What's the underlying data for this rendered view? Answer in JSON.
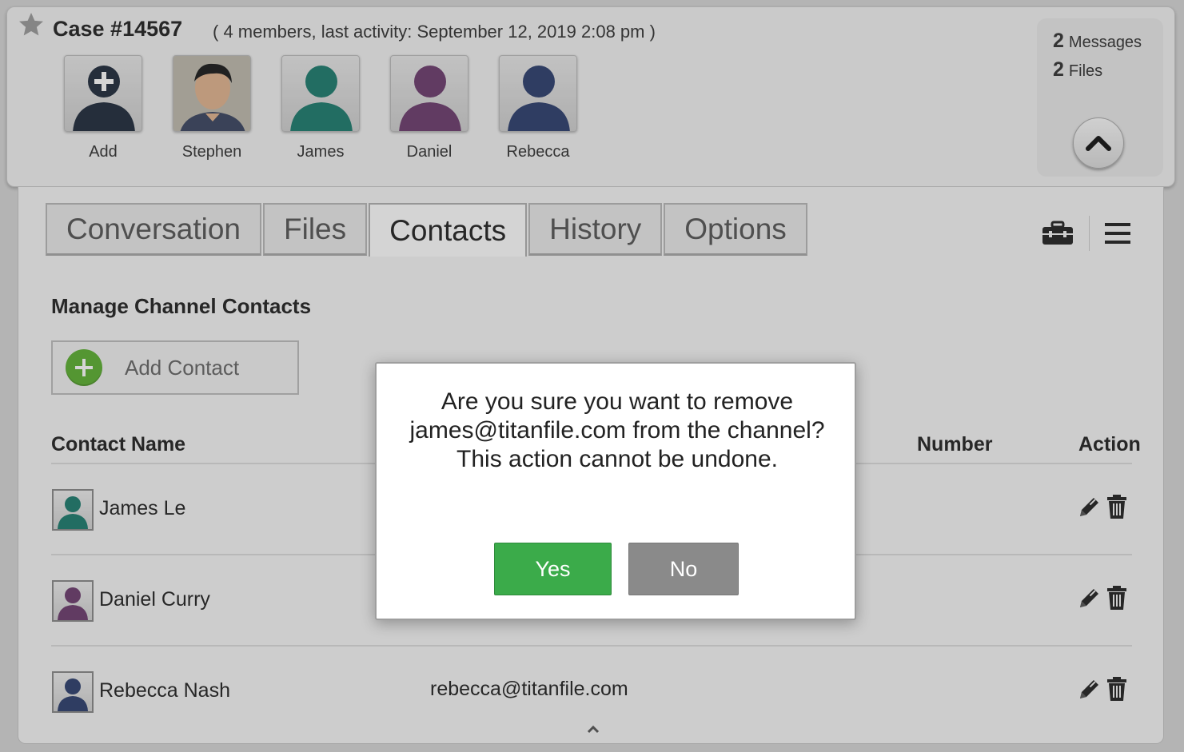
{
  "header": {
    "case_title": "Case #14567",
    "case_meta": "( 4 members, last activity: September 12, 2019 2:08 pm )",
    "members": [
      {
        "label": "Add",
        "color": "#1f2b3c"
      },
      {
        "label": "Stephen",
        "color": "photo"
      },
      {
        "label": "James",
        "color": "#1c7c6e"
      },
      {
        "label": "Daniel",
        "color": "#6c3b6e"
      },
      {
        "label": "Rebecca",
        "color": "#2c3e6e"
      }
    ],
    "stats": {
      "messages_count": "2",
      "messages_label": "Messages",
      "files_count": "2",
      "files_label": "Files"
    }
  },
  "tabs": [
    {
      "label": "Conversation",
      "active": false
    },
    {
      "label": "Files",
      "active": false
    },
    {
      "label": "Contacts",
      "active": true
    },
    {
      "label": "History",
      "active": false
    },
    {
      "label": "Options",
      "active": false
    }
  ],
  "contacts": {
    "section_title": "Manage Channel Contacts",
    "add_contact_label": "Add Contact",
    "columns": {
      "name": "Contact Name",
      "number": "Number",
      "action": "Action"
    },
    "rows": [
      {
        "name": "James Le",
        "email": "",
        "avatar_color": "#1c7c6e"
      },
      {
        "name": "Daniel Curry",
        "email": "",
        "avatar_color": "#6c3b6e"
      },
      {
        "name": "Rebecca Nash",
        "email": "rebecca@titanfile.com",
        "avatar_color": "#2c3e6e"
      }
    ]
  },
  "modal": {
    "message": "Are you sure you want to remove james@titanfile.com from the channel? This action cannot be undone.",
    "yes_label": "Yes",
    "no_label": "No"
  },
  "icons": {
    "star": "star-icon",
    "collapse": "chevron-up-icon",
    "toolbox": "toolbox-icon",
    "menu": "hamburger-menu-icon",
    "edit": "pencil-icon",
    "delete": "trash-icon"
  }
}
